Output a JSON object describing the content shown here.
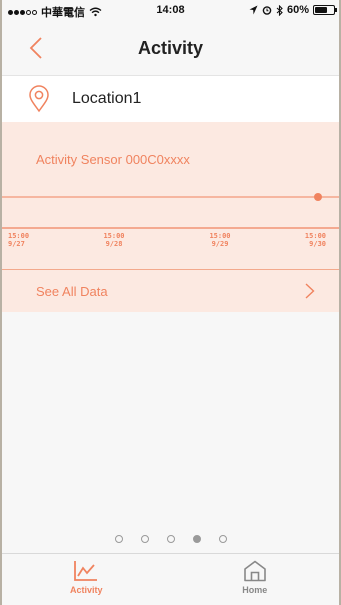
{
  "status_bar": {
    "carrier": "中華電信",
    "time": "14:08",
    "battery_percent": "60%",
    "battery_level": 0.6,
    "signal_dots_filled": 3,
    "signal_dots_total": 5
  },
  "nav": {
    "title": "Activity",
    "back_icon": "chevron-left-icon"
  },
  "location": {
    "name": "Location1",
    "icon": "map-pin-icon"
  },
  "card": {
    "sensor_title": "Activity Sensor 000C0xxxx",
    "see_all_label": "See All Data",
    "chevron_icon": "chevron-right-icon"
  },
  "chart_data": {
    "type": "line",
    "x_ticks": [
      {
        "time": "15:00",
        "date": "9/27"
      },
      {
        "time": "15:00",
        "date": "9/28"
      },
      {
        "time": "15:00",
        "date": "9/29"
      },
      {
        "time": "15:00",
        "date": "9/30"
      }
    ],
    "series": [
      {
        "values": [
          0,
          0,
          0,
          0
        ]
      }
    ],
    "grid": false,
    "marker_at": "last",
    "accent_color": "#f0835f"
  },
  "pager": {
    "count": 5,
    "active_index": 3
  },
  "tabs": [
    {
      "label": "Activity",
      "icon": "line-chart-icon",
      "active": true
    },
    {
      "label": "Home",
      "icon": "home-icon",
      "active": false
    }
  ],
  "colors": {
    "accent": "#f0835f",
    "card_bg": "#fce9e1",
    "inactive": "#888888"
  }
}
